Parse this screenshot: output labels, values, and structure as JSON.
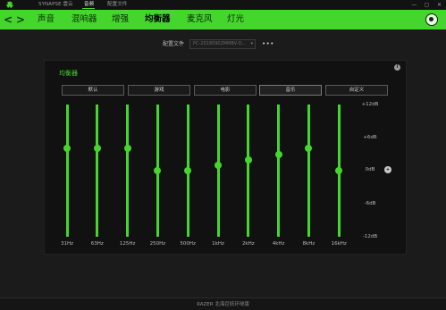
{
  "titlebar": {
    "tabs": [
      "SYNAPSE 雲云",
      "音频",
      "配置文件"
    ],
    "active_tab": "音频",
    "window_buttons": [
      "—",
      "▢",
      "✕"
    ]
  },
  "nav": {
    "back_icon": "<",
    "forward_icon": ">",
    "items": [
      "声音",
      "混响器",
      "增强",
      "均衡器",
      "麦克风",
      "灯光"
    ],
    "active": "均衡器"
  },
  "profile": {
    "label": "配置文件",
    "value": "PC-20180902MMBV-D...",
    "more": "•••"
  },
  "equalizer": {
    "title": "均衡器",
    "presets": [
      "默认",
      "游戏",
      "电影",
      "音乐",
      "自定义"
    ],
    "active_preset": "音乐",
    "db_labels": [
      "+12dB",
      "+6dB",
      "0dB",
      "-6dB",
      "-12dB"
    ],
    "bands": [
      {
        "freq": "31Hz",
        "db": 4
      },
      {
        "freq": "63Hz",
        "db": 4
      },
      {
        "freq": "125Hz",
        "db": 4
      },
      {
        "freq": "250Hz",
        "db": 0
      },
      {
        "freq": "500Hz",
        "db": 0
      },
      {
        "freq": "1kHz",
        "db": 1
      },
      {
        "freq": "2kHz",
        "db": 2
      },
      {
        "freq": "4kHz",
        "db": 3
      },
      {
        "freq": "8kHz",
        "db": 4
      },
      {
        "freq": "16kHz",
        "db": 0
      }
    ],
    "db_range": [
      -12,
      12
    ]
  },
  "footer": {
    "text": "RAZER 北海巨妖环绕版"
  },
  "colors": {
    "accent": "#44d62c",
    "background": "#1b1b1b",
    "panel": "#111111"
  }
}
